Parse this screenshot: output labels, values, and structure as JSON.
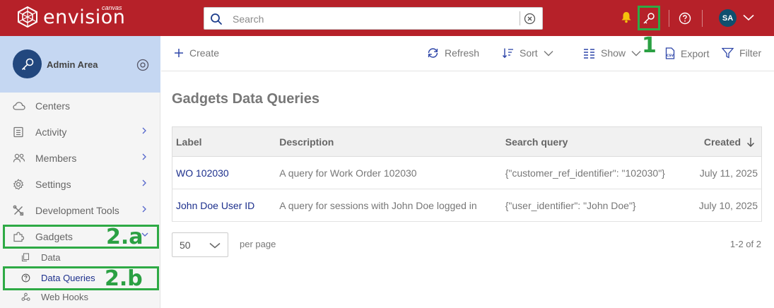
{
  "brand": {
    "name": "envision",
    "sub": "canvas"
  },
  "search": {
    "placeholder": "Search"
  },
  "topbar": {
    "avatar_initials": "SA"
  },
  "sidebar": {
    "admin_title": "Admin Area",
    "items": [
      {
        "label": "Centers",
        "icon": "cloud-icon"
      },
      {
        "label": "Activity",
        "icon": "list-icon"
      },
      {
        "label": "Members",
        "icon": "people-icon"
      },
      {
        "label": "Settings",
        "icon": "gear-icon"
      },
      {
        "label": "Development Tools",
        "icon": "tools-icon"
      },
      {
        "label": "Gadgets",
        "icon": "puzzle-icon"
      }
    ],
    "sub_items": [
      {
        "label": "Data",
        "icon": "copy-icon"
      },
      {
        "label": "Data Queries",
        "icon": "question-circle-icon"
      },
      {
        "label": "Web Hooks",
        "icon": "webhook-icon"
      }
    ]
  },
  "toolbar": {
    "create": "Create",
    "refresh": "Refresh",
    "sort": "Sort",
    "show": "Show",
    "export": "Export",
    "filter": "Filter"
  },
  "page": {
    "title": "Gadgets Data Queries"
  },
  "table": {
    "headers": {
      "label": "Label",
      "description": "Description",
      "query": "Search query",
      "created": "Created"
    },
    "rows": [
      {
        "label": "WO 102030",
        "description": "A query for Work Order 102030",
        "query": "{\"customer_ref_identifier\": \"102030\"}",
        "created": "July 11, 2025"
      },
      {
        "label": "John Doe User ID",
        "description": "A query for sessions with John Doe logged in",
        "query": "{\"user_identifier\": \"John Doe\"}",
        "created": "July 10, 2025"
      }
    ]
  },
  "pagination": {
    "per_page_value": "50",
    "per_page_label": "per page",
    "range": "1-2 of 2"
  },
  "annotations": {
    "a1": "1",
    "a2a": "2.a",
    "a2b": "2.b"
  },
  "colors": {
    "brand_red": "#b62129",
    "highlight_green": "#2eaa45",
    "link_blue": "#1c2f8c",
    "admin_bg": "#c5d7f2"
  }
}
